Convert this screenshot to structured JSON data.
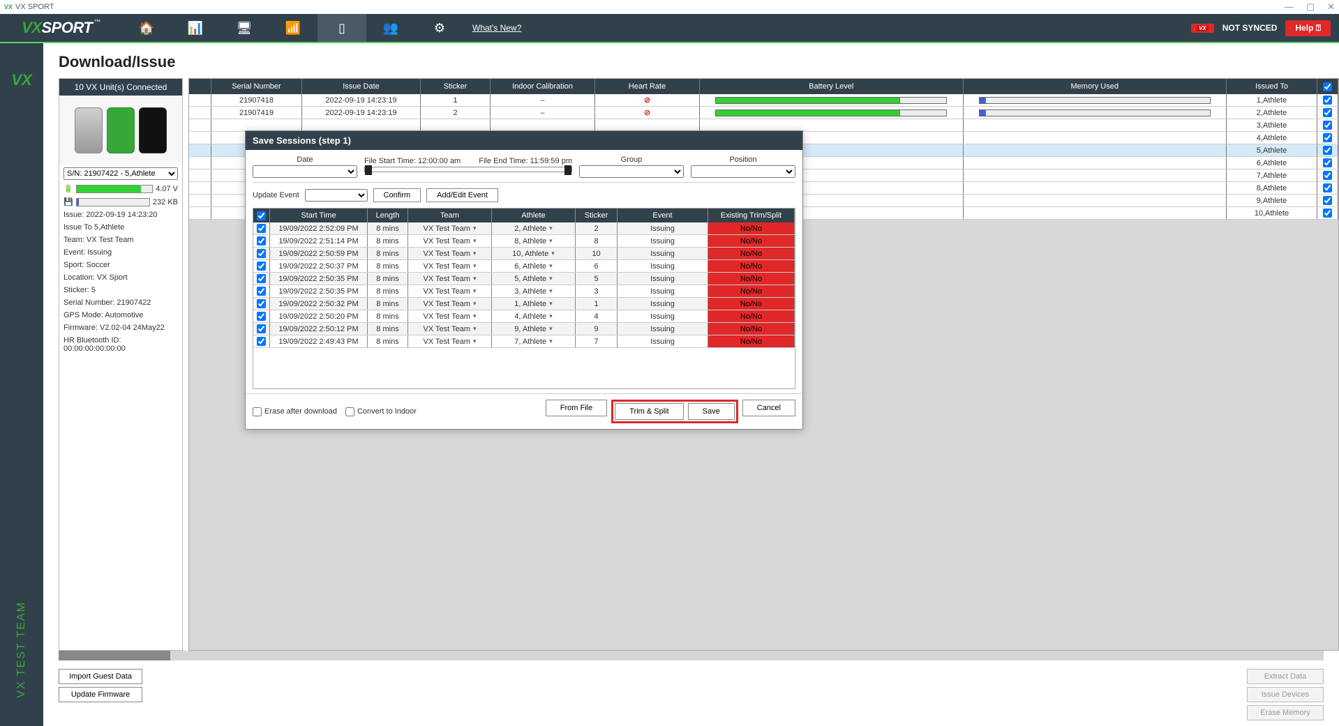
{
  "window": {
    "title": "VX SPORT"
  },
  "topbar": {
    "logo_prefix": "VX",
    "logo_suffix": "SPORT",
    "whats_new": "What's New?",
    "sync_status": "NOT SYNCED",
    "help": "Help ⍰"
  },
  "leftrail": {
    "vx": "VX",
    "team": "VX TEST TEAM"
  },
  "page": {
    "title": "Download/Issue"
  },
  "sidebar": {
    "header": "10 VX Unit(s) Connected",
    "serial_select": "S/N: 21907422 - 5,Athlete",
    "batt_v": "4.07 V",
    "mem_kb": "232 KB",
    "info": [
      "Issue: 2022-09-19 14:23:20",
      "Issue To 5,Athlete",
      "Team: VX Test Team",
      "Event: Issuing",
      "Sport:  Soccer",
      "Location: VX Sport",
      "Sticker: 5",
      "Serial Number: 21907422",
      "GPS Mode: Automotive",
      "Firmware: V2.02-04 24May22",
      "HR Bluetooth ID:  00:00:00:00:00:00"
    ]
  },
  "grid": {
    "headers": [
      "",
      "Serial Number",
      "Issue Date",
      "Sticker",
      "Indoor Calibration",
      "Heart Rate",
      "Battery Level",
      "Memory Used",
      "Issued To",
      ""
    ],
    "rows": [
      {
        "sn": "21907418",
        "date": "2022-09-19 14:23:19",
        "stk": "1",
        "cal": "–",
        "hr": "!",
        "bat": 80,
        "mem": 2,
        "iss": "1,Athlete",
        "chk": true
      },
      {
        "sn": "21907419",
        "date": "2022-09-19 14:23:19",
        "stk": "2",
        "cal": "–",
        "hr": "!",
        "bat": 80,
        "mem": 2,
        "iss": "2,Athlete",
        "chk": true
      }
    ],
    "issued_only": [
      "3,Athlete",
      "4,Athlete",
      "5,Athlete",
      "6,Athlete",
      "7,Athlete",
      "8,Athlete",
      "9,Athlete",
      "10,Athlete"
    ]
  },
  "modal": {
    "title": "Save Sessions (step 1)",
    "date_label": "Date",
    "file_start": "File Start Time: 12:00:00 am",
    "file_end": "File End Time: 11:59:59 pm",
    "group_label": "Group",
    "position_label": "Position",
    "update_event": "Update Event",
    "confirm": "Confirm",
    "add_edit": "Add/Edit Event",
    "headers": [
      "",
      "Start Time",
      "Length",
      "Team",
      "Athlete",
      "Sticker",
      "Event",
      "Existing Trim/Split"
    ],
    "rows": [
      {
        "st": "19/09/2022 2:52:09 PM",
        "len": "8 mins",
        "team": "VX Test Team",
        "ath": "2, Athlete",
        "stk": "2",
        "ev": "Issuing",
        "trim": "No/No"
      },
      {
        "st": "19/09/2022 2:51:14 PM",
        "len": "8 mins",
        "team": "VX Test Team",
        "ath": "8, Athlete",
        "stk": "8",
        "ev": "Issuing",
        "trim": "No/No"
      },
      {
        "st": "19/09/2022 2:50:59 PM",
        "len": "8 mins",
        "team": "VX Test Team",
        "ath": "10, Athlete",
        "stk": "10",
        "ev": "Issuing",
        "trim": "No/No"
      },
      {
        "st": "19/09/2022 2:50:37 PM",
        "len": "8 mins",
        "team": "VX Test Team",
        "ath": "6, Athlete",
        "stk": "6",
        "ev": "Issuing",
        "trim": "No/No"
      },
      {
        "st": "19/09/2022 2:50:35 PM",
        "len": "8 mins",
        "team": "VX Test Team",
        "ath": "5, Athlete",
        "stk": "5",
        "ev": "Issuing",
        "trim": "No/No"
      },
      {
        "st": "19/09/2022 2:50:35 PM",
        "len": "8 mins",
        "team": "VX Test Team",
        "ath": "3, Athlete",
        "stk": "3",
        "ev": "Issuing",
        "trim": "No/No"
      },
      {
        "st": "19/09/2022 2:50:32 PM",
        "len": "8 mins",
        "team": "VX Test Team",
        "ath": "1, Athlete",
        "stk": "1",
        "ev": "Issuing",
        "trim": "No/No"
      },
      {
        "st": "19/09/2022 2:50:20 PM",
        "len": "8 mins",
        "team": "VX Test Team",
        "ath": "4, Athlete",
        "stk": "4",
        "ev": "Issuing",
        "trim": "No/No"
      },
      {
        "st": "19/09/2022 2:50:12 PM",
        "len": "8 mins",
        "team": "VX Test Team",
        "ath": "9, Athlete",
        "stk": "9",
        "ev": "Issuing",
        "trim": "No/No"
      },
      {
        "st": "19/09/2022 2:49:43 PM",
        "len": "8 mins",
        "team": "VX Test Team",
        "ath": "7, Athlete",
        "stk": "7",
        "ev": "Issuing",
        "trim": "No/No"
      }
    ],
    "erase_after": "Erase after download",
    "convert_indoor": "Convert to Indoor",
    "from_file": "From File",
    "trim_split": "Trim & Split",
    "save": "Save",
    "cancel": "Cancel"
  },
  "bottom": {
    "import_guest": "Import Guest Data",
    "update_fw": "Update Firmware",
    "extract": "Extract Data",
    "issue_dev": "Issue Devices",
    "erase_mem": "Erase Memory"
  }
}
